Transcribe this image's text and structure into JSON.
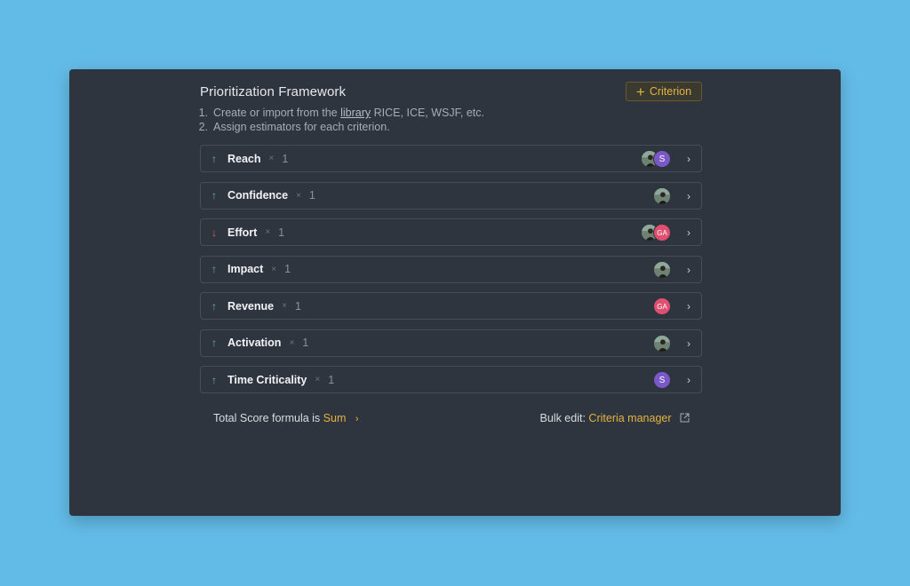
{
  "panel": {
    "title": "Prioritization Framework",
    "add_button": "Criterion",
    "steps": [
      {
        "num": "1.",
        "before": "Create or import from the",
        "link": "library",
        "after": "RICE, ICE, WSJF, etc."
      },
      {
        "num": "2.",
        "text": "Assign estimators for each criterion."
      }
    ]
  },
  "criteria": [
    {
      "name": "Reach",
      "direction": "up",
      "weight": "1",
      "estimators": [
        "photo",
        "S"
      ]
    },
    {
      "name": "Confidence",
      "direction": "up",
      "weight": "1",
      "estimators": [
        "photo"
      ]
    },
    {
      "name": "Effort",
      "direction": "down",
      "weight": "1",
      "estimators": [
        "photo",
        "GA"
      ]
    },
    {
      "name": "Impact",
      "direction": "up",
      "weight": "1",
      "estimators": [
        "photo"
      ]
    },
    {
      "name": "Revenue",
      "direction": "up",
      "weight": "1",
      "estimators": [
        "GA"
      ]
    },
    {
      "name": "Activation",
      "direction": "up",
      "weight": "1",
      "estimators": [
        "photo"
      ]
    },
    {
      "name": "Time Criticality",
      "direction": "up",
      "weight": "1",
      "estimators": [
        "S"
      ]
    }
  ],
  "footer": {
    "formula_label": "Total Score formula is",
    "formula_value": "Sum",
    "bulk_label": "Bulk edit:",
    "bulk_link": "Criteria manager"
  },
  "symbols": {
    "times": "×",
    "arrow_up": "↑",
    "arrow_down": "↓",
    "chevron": "›"
  },
  "colors": {
    "background": "#62bbe6",
    "panel": "#2f353e",
    "accent": "#e3b341",
    "up": "#5fbf7f",
    "down": "#e55b4d",
    "avatar_s": "#7a58c7",
    "avatar_ga": "#df4f6f"
  }
}
